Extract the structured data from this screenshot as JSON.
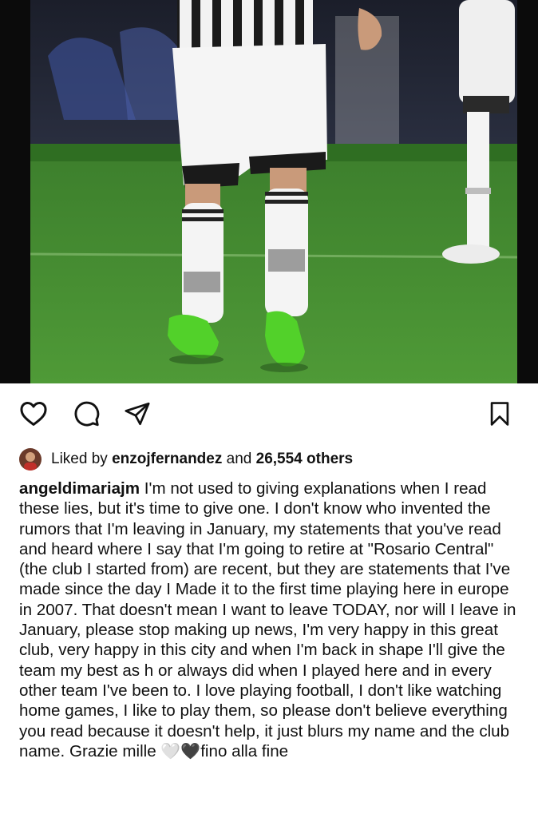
{
  "post": {
    "photo_alt_semantic": "football-player-photo"
  },
  "actions": {
    "like_icon": "heart-icon",
    "comment_icon": "comment-icon",
    "share_icon": "send-icon",
    "save_icon": "bookmark-icon"
  },
  "likes": {
    "prefix": "Liked by",
    "user": "enzojfernandez",
    "connector": "and",
    "count": "26,554 others"
  },
  "caption": {
    "author": "angeldimariajm",
    "text": " I'm not used to giving explanations when I read these lies, but it's time to give one. I don't know who invented the rumors that I'm leaving in January, my statements that you've read and heard where I say that I'm going to retire at \"Rosario Central\" (the club I started from) are recent, but they are statements that I've made since the day I Made it to the first time playing here in europe in 2007. That doesn't mean I want to leave TODAY, nor will I leave in January, please stop making up news, I'm very happy in this great club, very happy in this city and when I'm back in shape I'll give the team my best as h or always did when I played here and in every other team I've been to. I love playing football, I don't like watching home games, I like to play them, so please don't believe everything you read because it doesn't help, it just blurs my name and the club name. Grazie mille ",
    "emoji_1": "🤍",
    "emoji_2": "🖤",
    "tail": "fino alla fine"
  },
  "colors": {
    "pitch": "#3f8a2e",
    "pitch_dark": "#2f6e22",
    "boot_green": "#52d12a",
    "text": "#111111"
  }
}
